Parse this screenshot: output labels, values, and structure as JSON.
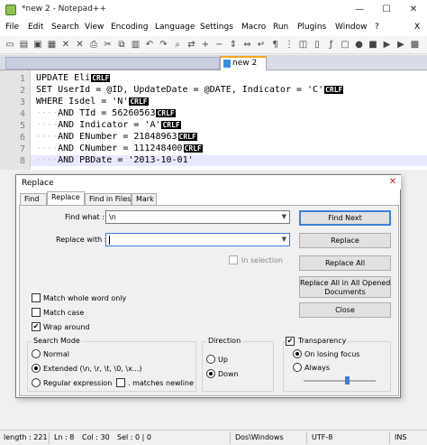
{
  "window": {
    "title": "*new 2 - Notepad++",
    "minimize": "—",
    "maximize": "☐",
    "close": "✕"
  },
  "menu": [
    "File",
    "Edit",
    "Search",
    "View",
    "Encoding",
    "Language",
    "Settings",
    "Macro",
    "Run",
    "Plugins",
    "Window",
    "?"
  ],
  "menu_close": "X",
  "toolbar_icons": [
    "new-file-icon",
    "open-file-icon",
    "save-icon",
    "save-all-icon",
    "close-icon",
    "close-all-icon",
    "print-icon",
    "cut-icon",
    "copy-icon",
    "paste-icon",
    "undo-icon",
    "redo-icon",
    "find-icon",
    "replace-icon",
    "zoom-in-icon",
    "zoom-out-icon",
    "sync-v-icon",
    "sync-h-icon",
    "word-wrap-icon",
    "all-chars-icon",
    "indent-guide-icon",
    "user-lang-icon",
    "doc-map-icon",
    "function-list-icon",
    "folder-workspace-icon",
    "record-icon",
    "stop-icon",
    "play-icon",
    "play-multi-icon",
    "save-macro-icon"
  ],
  "tabs": {
    "active_label": "new 2"
  },
  "editor": {
    "line_numbers": [
      "1",
      "2",
      "3",
      "4",
      "5",
      "6",
      "7",
      "8"
    ],
    "lines": [
      {
        "text": "UPDATE Eli",
        "crlf": "CRLF"
      },
      {
        "text": "SET UserId = @ID, UpdateDate = @DATE, Indicator = 'C'",
        "crlf": "CRLF"
      },
      {
        "text": "WHERE Isdel = 'N'",
        "crlf": "CRLF"
      },
      {
        "text": "AND TId = 56260563",
        "crlf": "CRLF",
        "indent": "····"
      },
      {
        "text": "AND Indicator = 'A'",
        "crlf": "CRLF",
        "indent": "····"
      },
      {
        "text": "AND ENumber = 21848963",
        "crlf": "CRLF",
        "indent": "····"
      },
      {
        "text": "AND CNumber = 111248400",
        "crlf": "CRLF",
        "indent": "····"
      },
      {
        "text": "AND PBDate = '2013-10-01'",
        "crlf": "",
        "indent": "····"
      }
    ]
  },
  "dialog": {
    "title": "Replace",
    "close": "✕",
    "tabs": [
      "Find",
      "Replace",
      "Find in Files",
      "Mark"
    ],
    "find_what_label": "Find what :",
    "find_what_value": "\\n",
    "replace_with_label": "Replace with :",
    "replace_with_value": "",
    "in_selection": "In selection",
    "buttons": {
      "find_next": "Find Next",
      "replace": "Replace",
      "replace_all": "Replace All",
      "replace_all_open_1": "Replace All in All Opened",
      "replace_all_open_2": "Documents",
      "close": "Close"
    },
    "options": {
      "match_whole_word": "Match whole word only",
      "match_case": "Match case",
      "wrap_around": "Wrap around",
      "match_whole_word_checked": false,
      "match_case_checked": false,
      "wrap_around_checked": true
    },
    "search_mode": {
      "title": "Search Mode",
      "normal": "Normal",
      "extended": "Extended (\\n, \\r, \\t, \\0, \\x...)",
      "regex": "Regular expression",
      "matches_newline": ". matches newline",
      "selected": "extended"
    },
    "direction": {
      "title": "Direction",
      "up": "Up",
      "down": "Down",
      "selected": "down"
    },
    "transparency": {
      "title": "Transparency",
      "on_losing_focus": "On losing focus",
      "always": "Always",
      "enabled": true,
      "selected": "on_losing_focus",
      "level": 0.6
    },
    "check_mark": "✔"
  },
  "status": {
    "length": "length : 221",
    "ln": "Ln : 8",
    "col": "Col : 30",
    "sel": "Sel : 0 | 0",
    "eol": "Dos\\Windows",
    "encoding": "UTF-8",
    "mode": "INS"
  }
}
